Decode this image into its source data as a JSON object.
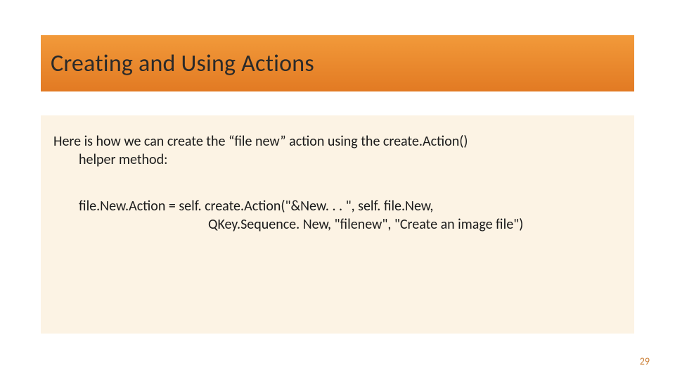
{
  "title": "Creating and Using Actions",
  "intro_line1": "Here is how we can create the “file new” action using the create.Action()",
  "intro_line2": "helper method:",
  "code_line1": "file.New.Action = self. create.Action(\"&New. . . \", self. file.New,",
  "code_line2": "QKey.Sequence. New, \"filenew\", \"Create an image file\")",
  "page_number": "29"
}
